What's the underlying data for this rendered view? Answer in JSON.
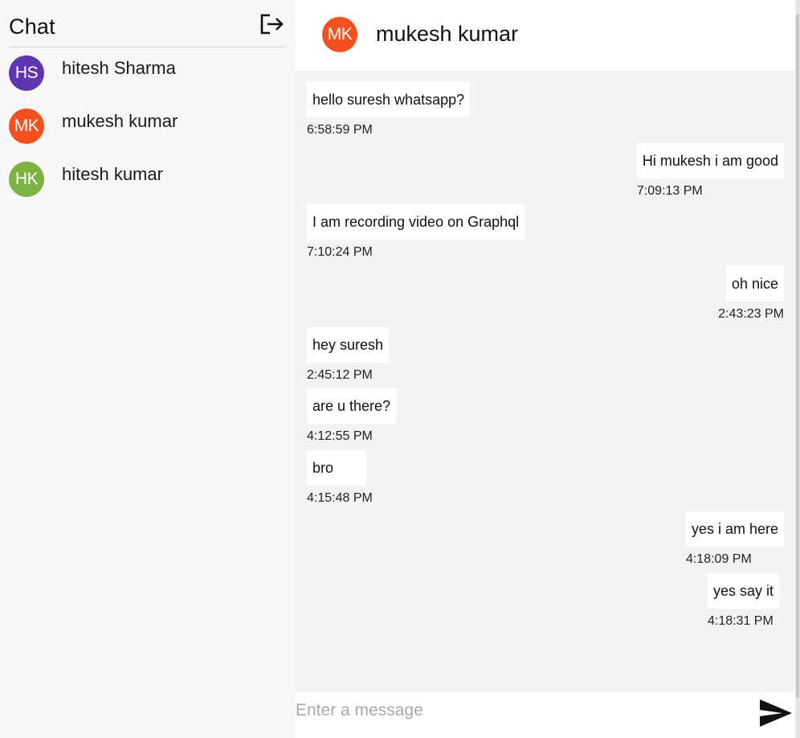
{
  "sidebar": {
    "title": "Chat",
    "logout_icon": "logout-icon",
    "contacts": [
      {
        "initials": "HS",
        "name": "hitesh Sharma",
        "color": "#5e35b1"
      },
      {
        "initials": "MK",
        "name": "mukesh kumar",
        "color": "#f4511e"
      },
      {
        "initials": "HK",
        "name": "hitesh kumar",
        "color": "#7cb342"
      }
    ]
  },
  "chat": {
    "header": {
      "initials": "MK",
      "name": "mukesh kumar",
      "color": "#f4511e"
    },
    "messages": [
      {
        "side": "left",
        "text": "hello suresh whatsapp?",
        "time": "6:58:59 PM"
      },
      {
        "side": "right",
        "text": "Hi mukesh i am good",
        "time": "7:09:13 PM"
      },
      {
        "side": "left",
        "text": "I am recording video on Graphql",
        "time": "7:10:24 PM"
      },
      {
        "side": "right",
        "text": "oh nice",
        "time": "2:43:23 PM"
      },
      {
        "side": "left",
        "text": "hey suresh",
        "time": "2:45:12 PM"
      },
      {
        "side": "left",
        "text": "are u there?",
        "time": "4:12:55 PM"
      },
      {
        "side": "left",
        "text": "bro",
        "time": "4:15:48 PM"
      },
      {
        "side": "right",
        "text": "yes i am here",
        "time": "4:18:09 PM"
      },
      {
        "side": "right",
        "text": "yes say it",
        "time": "4:18:31 PM"
      }
    ],
    "composer": {
      "placeholder": "Enter a message",
      "value": "",
      "send_icon": "send-icon"
    }
  }
}
